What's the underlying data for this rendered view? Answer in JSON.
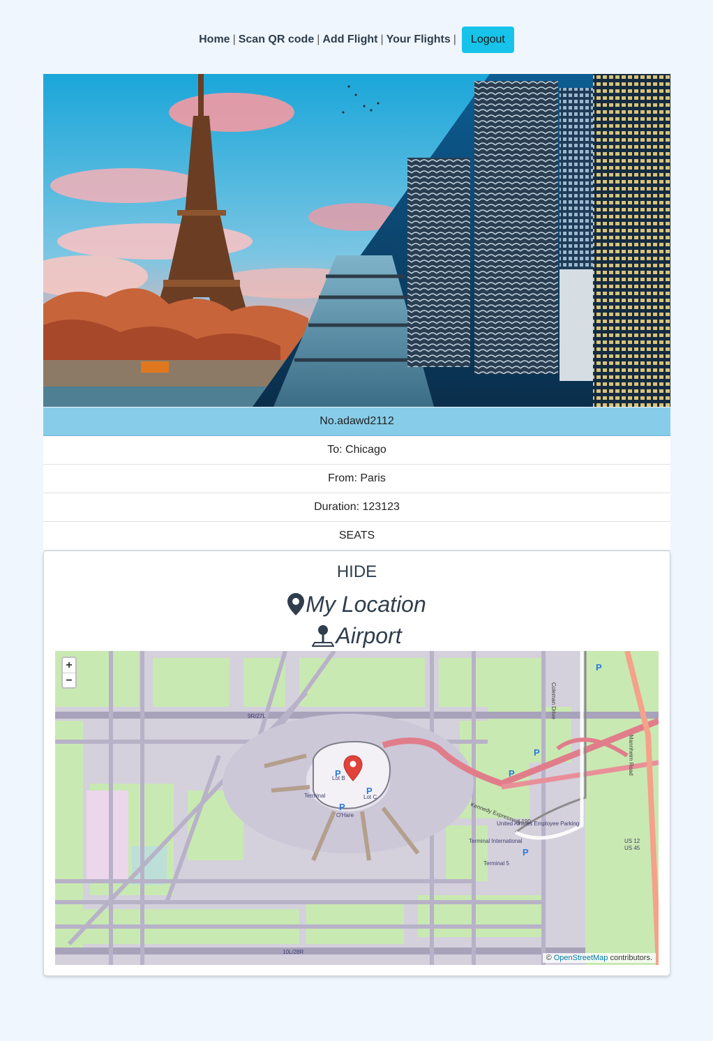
{
  "nav": {
    "home": "Home",
    "scan": "Scan QR code",
    "add": "Add Flight",
    "your": "Your Flights",
    "separator": "|",
    "logout": "Logout"
  },
  "flight": {
    "number": "No.adawd2112",
    "to": "To: Chicago",
    "from": "From: Paris",
    "duration": "Duration: 123123",
    "seats": "SEATS"
  },
  "card": {
    "hide": "HIDE",
    "my_location": "My Location",
    "airport": "Airport",
    "my_location_icon": "map-marker-icon",
    "airport_icon": "map-pin-person-icon"
  },
  "map": {
    "zoom_in": "+",
    "zoom_out": "−",
    "attribution_prefix": "©",
    "attribution_link": "OpenStreetMap",
    "attribution_suffix": "contributors.",
    "labels": {
      "lot_b": "Lot B",
      "lot_c": "Lot C",
      "terminal": "Terminal",
      "ohare": "O'Hare",
      "terminal_intl": "Terminal International",
      "terminal_5": "Terminal 5",
      "kennedy": "Kennedy Expressway",
      "i190": "I 190",
      "mannheim": "Mannheim Road",
      "united": "United Airlines Employee Parking",
      "coleman": "Coleman Drive",
      "runway_9r": "9R/27L",
      "runway_10l": "10L/28R",
      "us12": "US 12",
      "us45": "US 45"
    }
  },
  "colors": {
    "page_bg": "#eff6fd",
    "header_row": "#87cdea",
    "logout_bg": "#17c3e8",
    "text_dark": "#2f3d4c",
    "marker_red": "#e0433a"
  }
}
